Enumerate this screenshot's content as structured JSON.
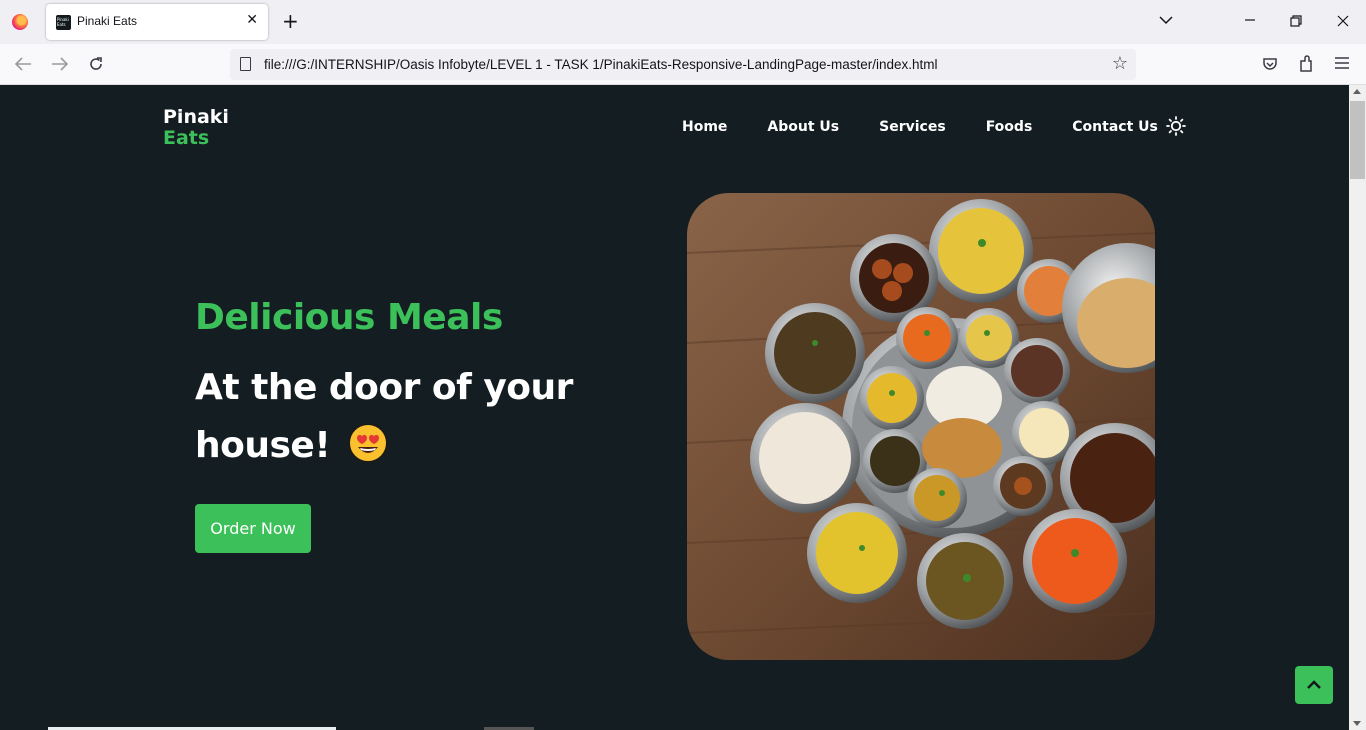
{
  "browser": {
    "tab_title": "Pinaki Eats",
    "favicon_text": "Pinaki Eats",
    "url": "file:///G:/INTERNSHIP/Oasis Infobyte/LEVEL 1 - TASK 1/PinakiEats-Responsive-LandingPage-master/index.html"
  },
  "site": {
    "logo_line1": "Pinaki",
    "logo_line2": "Eats",
    "nav": [
      "Home",
      "About Us",
      "Services",
      "Foods",
      "Contact Us"
    ],
    "theme_icon": "sun-icon",
    "hero_subtitle": "Delicious Meals",
    "hero_title": "At the door of your house!",
    "emoji_icon": "heart-eyes-emoji",
    "cta_label": "Order Now",
    "hero_image": "indian-thali-food-photo",
    "scroll_top_icon": "chevron-up-icon"
  },
  "colors": {
    "background": "#131d22",
    "accent": "#3cc15a",
    "text": "#ffffff"
  }
}
